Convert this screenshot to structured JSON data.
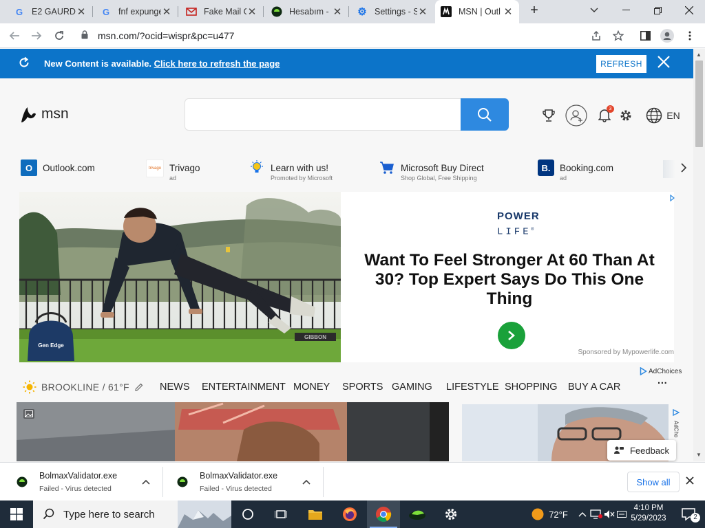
{
  "browser": {
    "tabs": [
      {
        "title": "E2 GAURDI",
        "icon": "google-icon",
        "active": false
      },
      {
        "title": "fnf expunge",
        "icon": "google-icon",
        "active": false
      },
      {
        "title": "Fake Mail G",
        "icon": "mail-icon",
        "active": false
      },
      {
        "title": "Hesabım -",
        "icon": "hesabim-icon",
        "active": false
      },
      {
        "title": "Settings - S",
        "icon": "settings-icon",
        "active": false
      },
      {
        "title": "MSN | Outl",
        "icon": "msn-icon",
        "active": true
      }
    ],
    "url": "msn.com/?ocid=wispr&pc=u477"
  },
  "notice": {
    "text": "New Content is available.",
    "link": "Click here to refresh the page",
    "button": "REFRESH"
  },
  "header": {
    "logo": "msn",
    "notification_count": "3",
    "language": "EN"
  },
  "quicklinks": [
    {
      "name": "Outlook.com",
      "sub": "",
      "icon": "outlook-icon",
      "color": "#0f6cbd"
    },
    {
      "name": "Trivago",
      "sub": "ad",
      "icon": "trivago-icon",
      "color": "#ffffff"
    },
    {
      "name": "Learn with us!",
      "sub": "Promoted by Microsoft",
      "icon": "lightbulb-icon",
      "color": "#ffffff"
    },
    {
      "name": "Microsoft Buy Direct",
      "sub": "Shop Global, Free Shipping",
      "icon": "cart-icon",
      "color": "#ffffff"
    },
    {
      "name": "Booking.com",
      "sub": "ad",
      "icon": "booking-icon",
      "color": "#003580"
    }
  ],
  "ad": {
    "brand_line1": "POWER",
    "brand_line2": "LIFE",
    "brand_mark": "®",
    "headline": "Want To Feel Stronger At 60 Than At 30? Top Expert Says Do This One Thing",
    "sponsor": "Sponsored by Mypowerlife.com",
    "adchoices": "AdChoices",
    "bag_text": "Gen Edge",
    "fence_sign": "GIBBON"
  },
  "nav": {
    "location": "BROOKLINE / 61°F",
    "items": [
      "NEWS",
      "ENTERTAINMENT",
      "MONEY",
      "SPORTS",
      "GAMING",
      "LIFESTYLE",
      "SHOPPING",
      "BUY A CAR"
    ],
    "more": "···"
  },
  "feed": {
    "adchoices": "AdCho",
    "feedback": "Feedback"
  },
  "downloads": {
    "items": [
      {
        "name": "BolmaxValidator.exe",
        "status": "Failed - Virus detected"
      },
      {
        "name": "BolmaxValidator.exe",
        "status": "Failed - Virus detected"
      }
    ],
    "show_all": "Show all"
  },
  "taskbar": {
    "search_placeholder": "Type here to search",
    "temperature": "72°F",
    "time": "4:10 PM",
    "date": "5/29/2023",
    "notifications": "2"
  }
}
